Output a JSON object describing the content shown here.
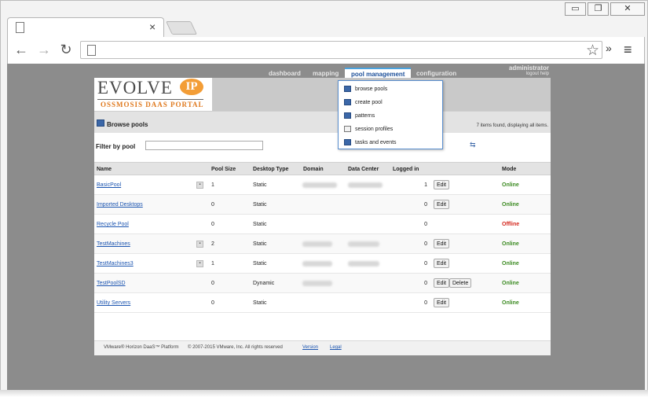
{
  "browser": {
    "minimize_glyph": "▭",
    "restore_glyph": "❐",
    "close_glyph": "✕",
    "tab_close_glyph": "×",
    "back_glyph": "←",
    "forward_glyph": "→",
    "reload_glyph": "↻",
    "star_glyph": "☆",
    "extensions_glyph": "»",
    "menu_glyph": "≡"
  },
  "header": {
    "logo_main": "EVOLVE",
    "logo_badge": "IP",
    "logo_sub": "OSSMOSIS DAAS PORTAL",
    "user_name": "administrator",
    "user_links": "logout   help"
  },
  "nav": {
    "items": [
      {
        "label": "dashboard"
      },
      {
        "label": "mapping"
      },
      {
        "label": "pool management"
      },
      {
        "label": "configuration"
      }
    ]
  },
  "dropdown": {
    "items": [
      {
        "label": "browse pools",
        "icon": "pool-icon"
      },
      {
        "label": "create pool",
        "icon": "create-pool-icon"
      },
      {
        "label": "patterns",
        "icon": "patterns-icon"
      },
      {
        "label": "session profiles",
        "icon": "session-profile-icon"
      },
      {
        "label": "tasks and events",
        "icon": "tasks-icon"
      }
    ]
  },
  "page": {
    "title": "Browse pools",
    "items_found": "7 items found, displaying all items.",
    "filter_label": "Filter by pool",
    "filter_value": "",
    "refresh_glyph": "⇆"
  },
  "table": {
    "columns": [
      "Name",
      "Pool Size",
      "Desktop Type",
      "Domain",
      "Data Center",
      "Logged in",
      "Mode"
    ],
    "rows": [
      {
        "name": "BasicPool",
        "pool_size": "1",
        "desktop_type": "Static",
        "logged_in": "1",
        "edit": "Edit",
        "delete": "",
        "mode": "Online"
      },
      {
        "name": "Imported Desktops",
        "pool_size": "0",
        "desktop_type": "Static",
        "logged_in": "0",
        "edit": "Edit",
        "delete": "",
        "mode": "Online"
      },
      {
        "name": "Recycle Pool",
        "pool_size": "0",
        "desktop_type": "Static",
        "logged_in": "0",
        "edit": "",
        "delete": "",
        "mode": "Offline"
      },
      {
        "name": "TestMachines",
        "pool_size": "2",
        "desktop_type": "Static",
        "logged_in": "0",
        "edit": "Edit",
        "delete": "",
        "mode": "Online"
      },
      {
        "name": "TestMachines3",
        "pool_size": "1",
        "desktop_type": "Static",
        "logged_in": "0",
        "edit": "Edit",
        "delete": "",
        "mode": "Online"
      },
      {
        "name": "TestPoolSD",
        "pool_size": "0",
        "desktop_type": "Dynamic",
        "logged_in": "0",
        "edit": "Edit",
        "delete": "Delete",
        "mode": "Online"
      },
      {
        "name": "Utility Servers",
        "pool_size": "0",
        "desktop_type": "Static",
        "logged_in": "0",
        "edit": "Edit",
        "delete": "",
        "mode": "Online"
      }
    ]
  },
  "footer": {
    "product": "VMware® Horizon DaaS™ Platform",
    "copyright": "© 2007-2015 VMware, Inc. All rights reserved",
    "version_link": "Version",
    "legal_link": "Legal"
  },
  "colors": {
    "link": "#1c55b0",
    "online": "#3c8b22",
    "offline": "#d4281e",
    "logo_orange": "#f39d36"
  }
}
